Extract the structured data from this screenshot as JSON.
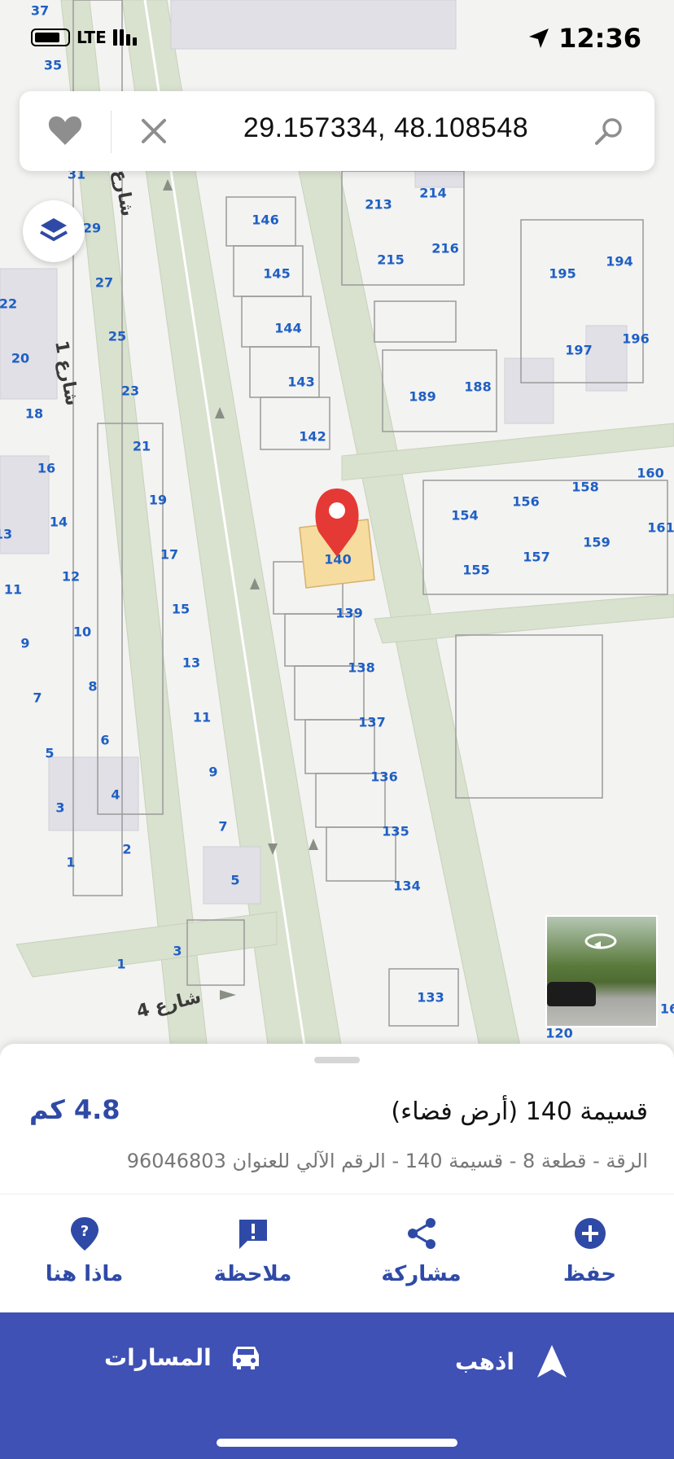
{
  "status": {
    "network": "LTE",
    "time": "12:36"
  },
  "search": {
    "query": "29.157334, 48.108548"
  },
  "map": {
    "streets": [
      "شارع 1",
      "شارع 4",
      "شارع"
    ],
    "plots": [
      "37",
      "35",
      "31",
      "29",
      "27",
      "25",
      "23",
      "21",
      "19",
      "17",
      "15",
      "13",
      "11",
      "9",
      "7",
      "5",
      "1",
      "3",
      "22",
      "20",
      "18",
      "16",
      "14",
      "13",
      "12",
      "11",
      "10",
      "9",
      "8",
      "7",
      "6",
      "5",
      "4",
      "3",
      "2",
      "1",
      "146",
      "145",
      "144",
      "143",
      "142",
      "140",
      "139",
      "138",
      "137",
      "136",
      "135",
      "134",
      "133",
      "213",
      "214",
      "215",
      "216",
      "189",
      "188",
      "195",
      "194",
      "197",
      "196",
      "154",
      "156",
      "158",
      "160",
      "161",
      "155",
      "157",
      "159",
      "120",
      "16"
    ],
    "selected_plot": "140"
  },
  "sheet": {
    "title": "قسيمة 140 (أرض فضاء)",
    "distance": "4.8 كم",
    "subtitle": "الرقة - قطعة 8 - قسيمة 140 - الرقم الآلي للعنوان 96046803"
  },
  "actions": [
    {
      "label": "حفظ",
      "icon": "plus-circle-icon"
    },
    {
      "label": "مشاركة",
      "icon": "share-icon"
    },
    {
      "label": "ملاحظة",
      "icon": "note-icon"
    },
    {
      "label": "ماذا هنا",
      "icon": "question-pin-icon"
    }
  ],
  "nav": {
    "go_label": "اذهب",
    "routes_label": "المسارات"
  },
  "colors": {
    "accent": "#3f51b5",
    "action_text": "#2f4aa6",
    "plot_label": "#1f5fc4",
    "selected_plot": "#f7dca0",
    "pin": "#e53935"
  }
}
